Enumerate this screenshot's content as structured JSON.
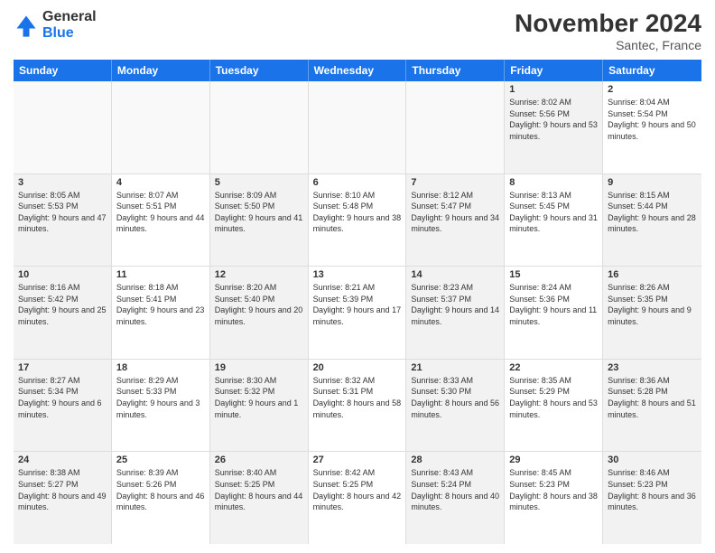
{
  "logo": {
    "line1": "General",
    "line2": "Blue"
  },
  "title": "November 2024",
  "location": "Santec, France",
  "header_days": [
    "Sunday",
    "Monday",
    "Tuesday",
    "Wednesday",
    "Thursday",
    "Friday",
    "Saturday"
  ],
  "rows": [
    [
      {
        "day": "",
        "info": "",
        "empty": true
      },
      {
        "day": "",
        "info": "",
        "empty": true
      },
      {
        "day": "",
        "info": "",
        "empty": true
      },
      {
        "day": "",
        "info": "",
        "empty": true
      },
      {
        "day": "",
        "info": "",
        "empty": true
      },
      {
        "day": "1",
        "info": "Sunrise: 8:02 AM\nSunset: 5:56 PM\nDaylight: 9 hours and 53 minutes.",
        "shaded": true
      },
      {
        "day": "2",
        "info": "Sunrise: 8:04 AM\nSunset: 5:54 PM\nDaylight: 9 hours and 50 minutes.",
        "shaded": false
      }
    ],
    [
      {
        "day": "3",
        "info": "Sunrise: 8:05 AM\nSunset: 5:53 PM\nDaylight: 9 hours and 47 minutes.",
        "shaded": true
      },
      {
        "day": "4",
        "info": "Sunrise: 8:07 AM\nSunset: 5:51 PM\nDaylight: 9 hours and 44 minutes.",
        "shaded": false
      },
      {
        "day": "5",
        "info": "Sunrise: 8:09 AM\nSunset: 5:50 PM\nDaylight: 9 hours and 41 minutes.",
        "shaded": true
      },
      {
        "day": "6",
        "info": "Sunrise: 8:10 AM\nSunset: 5:48 PM\nDaylight: 9 hours and 38 minutes.",
        "shaded": false
      },
      {
        "day": "7",
        "info": "Sunrise: 8:12 AM\nSunset: 5:47 PM\nDaylight: 9 hours and 34 minutes.",
        "shaded": true
      },
      {
        "day": "8",
        "info": "Sunrise: 8:13 AM\nSunset: 5:45 PM\nDaylight: 9 hours and 31 minutes.",
        "shaded": false
      },
      {
        "day": "9",
        "info": "Sunrise: 8:15 AM\nSunset: 5:44 PM\nDaylight: 9 hours and 28 minutes.",
        "shaded": true
      }
    ],
    [
      {
        "day": "10",
        "info": "Sunrise: 8:16 AM\nSunset: 5:42 PM\nDaylight: 9 hours and 25 minutes.",
        "shaded": true
      },
      {
        "day": "11",
        "info": "Sunrise: 8:18 AM\nSunset: 5:41 PM\nDaylight: 9 hours and 23 minutes.",
        "shaded": false
      },
      {
        "day": "12",
        "info": "Sunrise: 8:20 AM\nSunset: 5:40 PM\nDaylight: 9 hours and 20 minutes.",
        "shaded": true
      },
      {
        "day": "13",
        "info": "Sunrise: 8:21 AM\nSunset: 5:39 PM\nDaylight: 9 hours and 17 minutes.",
        "shaded": false
      },
      {
        "day": "14",
        "info": "Sunrise: 8:23 AM\nSunset: 5:37 PM\nDaylight: 9 hours and 14 minutes.",
        "shaded": true
      },
      {
        "day": "15",
        "info": "Sunrise: 8:24 AM\nSunset: 5:36 PM\nDaylight: 9 hours and 11 minutes.",
        "shaded": false
      },
      {
        "day": "16",
        "info": "Sunrise: 8:26 AM\nSunset: 5:35 PM\nDaylight: 9 hours and 9 minutes.",
        "shaded": true
      }
    ],
    [
      {
        "day": "17",
        "info": "Sunrise: 8:27 AM\nSunset: 5:34 PM\nDaylight: 9 hours and 6 minutes.",
        "shaded": true
      },
      {
        "day": "18",
        "info": "Sunrise: 8:29 AM\nSunset: 5:33 PM\nDaylight: 9 hours and 3 minutes.",
        "shaded": false
      },
      {
        "day": "19",
        "info": "Sunrise: 8:30 AM\nSunset: 5:32 PM\nDaylight: 9 hours and 1 minute.",
        "shaded": true
      },
      {
        "day": "20",
        "info": "Sunrise: 8:32 AM\nSunset: 5:31 PM\nDaylight: 8 hours and 58 minutes.",
        "shaded": false
      },
      {
        "day": "21",
        "info": "Sunrise: 8:33 AM\nSunset: 5:30 PM\nDaylight: 8 hours and 56 minutes.",
        "shaded": true
      },
      {
        "day": "22",
        "info": "Sunrise: 8:35 AM\nSunset: 5:29 PM\nDaylight: 8 hours and 53 minutes.",
        "shaded": false
      },
      {
        "day": "23",
        "info": "Sunrise: 8:36 AM\nSunset: 5:28 PM\nDaylight: 8 hours and 51 minutes.",
        "shaded": true
      }
    ],
    [
      {
        "day": "24",
        "info": "Sunrise: 8:38 AM\nSunset: 5:27 PM\nDaylight: 8 hours and 49 minutes.",
        "shaded": true
      },
      {
        "day": "25",
        "info": "Sunrise: 8:39 AM\nSunset: 5:26 PM\nDaylight: 8 hours and 46 minutes.",
        "shaded": false
      },
      {
        "day": "26",
        "info": "Sunrise: 8:40 AM\nSunset: 5:25 PM\nDaylight: 8 hours and 44 minutes.",
        "shaded": true
      },
      {
        "day": "27",
        "info": "Sunrise: 8:42 AM\nSunset: 5:25 PM\nDaylight: 8 hours and 42 minutes.",
        "shaded": false
      },
      {
        "day": "28",
        "info": "Sunrise: 8:43 AM\nSunset: 5:24 PM\nDaylight: 8 hours and 40 minutes.",
        "shaded": true
      },
      {
        "day": "29",
        "info": "Sunrise: 8:45 AM\nSunset: 5:23 PM\nDaylight: 8 hours and 38 minutes.",
        "shaded": false
      },
      {
        "day": "30",
        "info": "Sunrise: 8:46 AM\nSunset: 5:23 PM\nDaylight: 8 hours and 36 minutes.",
        "shaded": true
      }
    ]
  ]
}
